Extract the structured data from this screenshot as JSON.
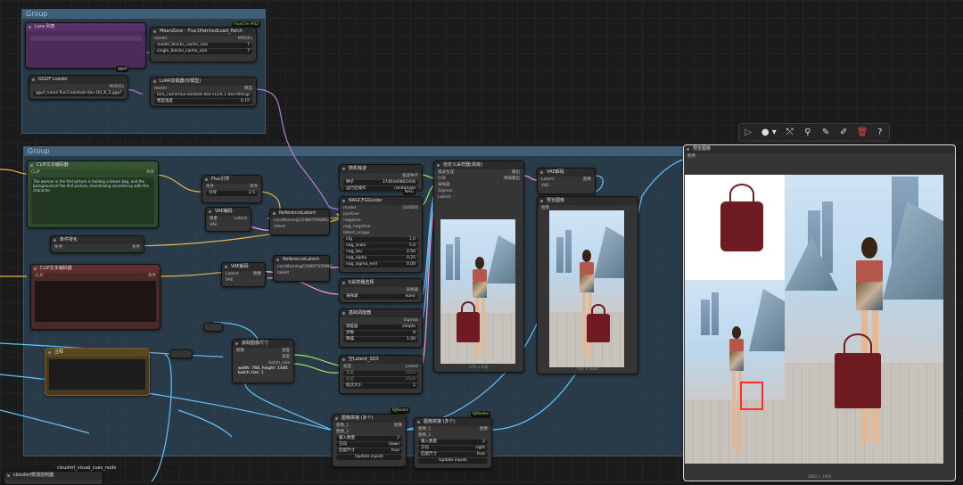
{
  "groups": {
    "top": "Group",
    "main": "Group"
  },
  "nodes": {
    "lora_stack": {
      "title": "Lora 列表",
      "id": "#95"
    },
    "magcache": {
      "title": "MeanZone - Flux1PatchedLoad_Patch",
      "in": "model",
      "out": "MODEL",
      "w1": "model_blocks_cache_size",
      "w1v": "7",
      "w2": "single_blocks_cache_size",
      "w2v": "7",
      "badge": "FluxCre #42"
    },
    "gguf": {
      "title": "GGUF Loader",
      "out": "MODEL",
      "label": "gguf_name",
      "value": "flux1-kontext-dev-Q4_K_S.gguf"
    },
    "lora_loader": {
      "title": "LoRA加载器(仅模型)",
      "in": "model",
      "out": "模型",
      "w1": "lora_name",
      "w1v": "flux-kontext-dev-FLUX.1-dev-fittings-lora.safetensors",
      "w2": "模型强度",
      "w2v": "0.15",
      "badge": "gguf"
    },
    "clip_pos": {
      "title": "CLIP文本编码器",
      "in": "CLIP",
      "out": "条件",
      "text": "The woman in the first picture is holding a brown bag, and the background of the first picture, maintaining consistency with the character.",
      "id": "#11"
    },
    "clip_neg": {
      "title": "CLIP文本编码器",
      "in": "CLIP",
      "out": "条件",
      "id": "#9"
    },
    "flux_guidance": {
      "title": "Flux引导",
      "in": "条件",
      "out": "条件",
      "w": "引导",
      "wv": "2.5",
      "id": "#9096"
    },
    "vae_encode": {
      "title": "VAE编码",
      "in1": "像素",
      "in2": "VAE",
      "out": "Latent",
      "id": "#96"
    },
    "vae_decode_mid": {
      "title": "VAE解码",
      "in1": "Latent",
      "in2": "VAE",
      "out": "图像"
    },
    "cond_zero": {
      "title": "条件零化",
      "in": "条件",
      "out": "条件",
      "id": "#8096"
    },
    "ref_latent1": {
      "title": "ReferenceLatent",
      "in": "conditioning",
      "in2": "latent",
      "out": "CONDITIONING",
      "id": "#9096"
    },
    "ref_latent2": {
      "title": "ReferenceLatent",
      "in": "conditioning",
      "in2": "latent",
      "out": "CONDITIONING"
    },
    "notes": {
      "title": "注释"
    },
    "get_size": {
      "title": "获取图像尺寸",
      "in": "图像",
      "o1": "宽度",
      "o2": "高度",
      "o3": "batch_size",
      "info1": "width: 768, height: 1440",
      "info2": "batch size: 1"
    },
    "seed": {
      "title": "随机噪波",
      "out": "噪波种子",
      "w1": "种子",
      "w1v": "3746440862406",
      "w2": "运行后操作",
      "w2v": "randomize",
      "badge": "NAG",
      "id": "#80"
    },
    "nag": {
      "title": "NAGCFGGuider",
      "i1": "model",
      "i2": "positive",
      "i3": "negative",
      "i4": "nag_negative",
      "i5": "latent_image",
      "out": "GUIDER",
      "w1": "cfg",
      "w1v": "1.0",
      "w2": "nag_scale",
      "w2v": "5.0",
      "w3": "nag_tau",
      "w3v": "2.50",
      "w4": "nag_alpha",
      "w4v": "0.25",
      "w5": "nag_sigma_end",
      "w5v": "0.00"
    },
    "ksampler_sel": {
      "title": "K采样器选择",
      "out": "采样器",
      "w": "采样器",
      "wv": "euler"
    },
    "scheduler": {
      "title": "基础调度器",
      "out": "Sigmas",
      "w1": "调度器",
      "w1v": "simple",
      "w2": "步数",
      "w2v": "8",
      "w3": "降噪",
      "w3v": "1.00"
    },
    "empty_latent": {
      "title": "空Latent_SD3",
      "in1": "宽度",
      "in2": "高度",
      "out": "Latent",
      "w1": "宽度",
      "w1v": "1024",
      "w2": "高度",
      "w2v": "1024",
      "w3": "批次大小",
      "w3v": "1"
    },
    "custom_sampler": {
      "title": "自定义采样器(高级)",
      "i1": "噪波生成",
      "i2": "引导",
      "i3": "采样器",
      "i4": "Sigmas",
      "i5": "Latent",
      "o1": "输出",
      "o2": "降噪输出",
      "id": "#89 #9096",
      "caption": "272 × 432"
    },
    "vae_decode_r": {
      "title": "VAE解码",
      "in1": "Latent",
      "in2": "VAE",
      "out": "图像",
      "id": "#1 29MB"
    },
    "preview_r": {
      "title": "预览图像",
      "in": "图像",
      "id": "#209MB",
      "caption": "512 × 1024"
    },
    "stitch1": {
      "title": "图像拼接 (多个)",
      "i1": "图像_1",
      "i2": "图像_2",
      "out": "图像",
      "w1": "输入数量",
      "w1v": "2",
      "w2": "方向",
      "w2v": "down",
      "w3": "匹配尺寸",
      "w3v": "true",
      "btn": "Update inputs",
      "badge": "KJNodes"
    },
    "stitch2": {
      "title": "图像拼接 (多个)",
      "i1": "图像_1",
      "i2": "图像_2",
      "out": "图像",
      "w1": "输入数量",
      "w1v": "2",
      "w2": "方向",
      "w2v": "right",
      "w3": "匹配尺寸",
      "w3v": "true",
      "btn": "Update inputs",
      "badge": "KJNodes",
      "id": "#78"
    },
    "preview_main": {
      "title": "预览图像",
      "in": "图像",
      "id": "#0978",
      "caption": "1803 × 1000"
    },
    "bottom_left": {
      "title": "cloudmf蒸馏控制器",
      "label": "cloudmf_visual_cues_node"
    }
  },
  "toolbar": {
    "icons": [
      "play-icon",
      "color-circle-icon",
      "bypass-icon",
      "pin-icon",
      "edit-icon",
      "pencil-icon",
      "delete-icon",
      "help-icon"
    ]
  }
}
